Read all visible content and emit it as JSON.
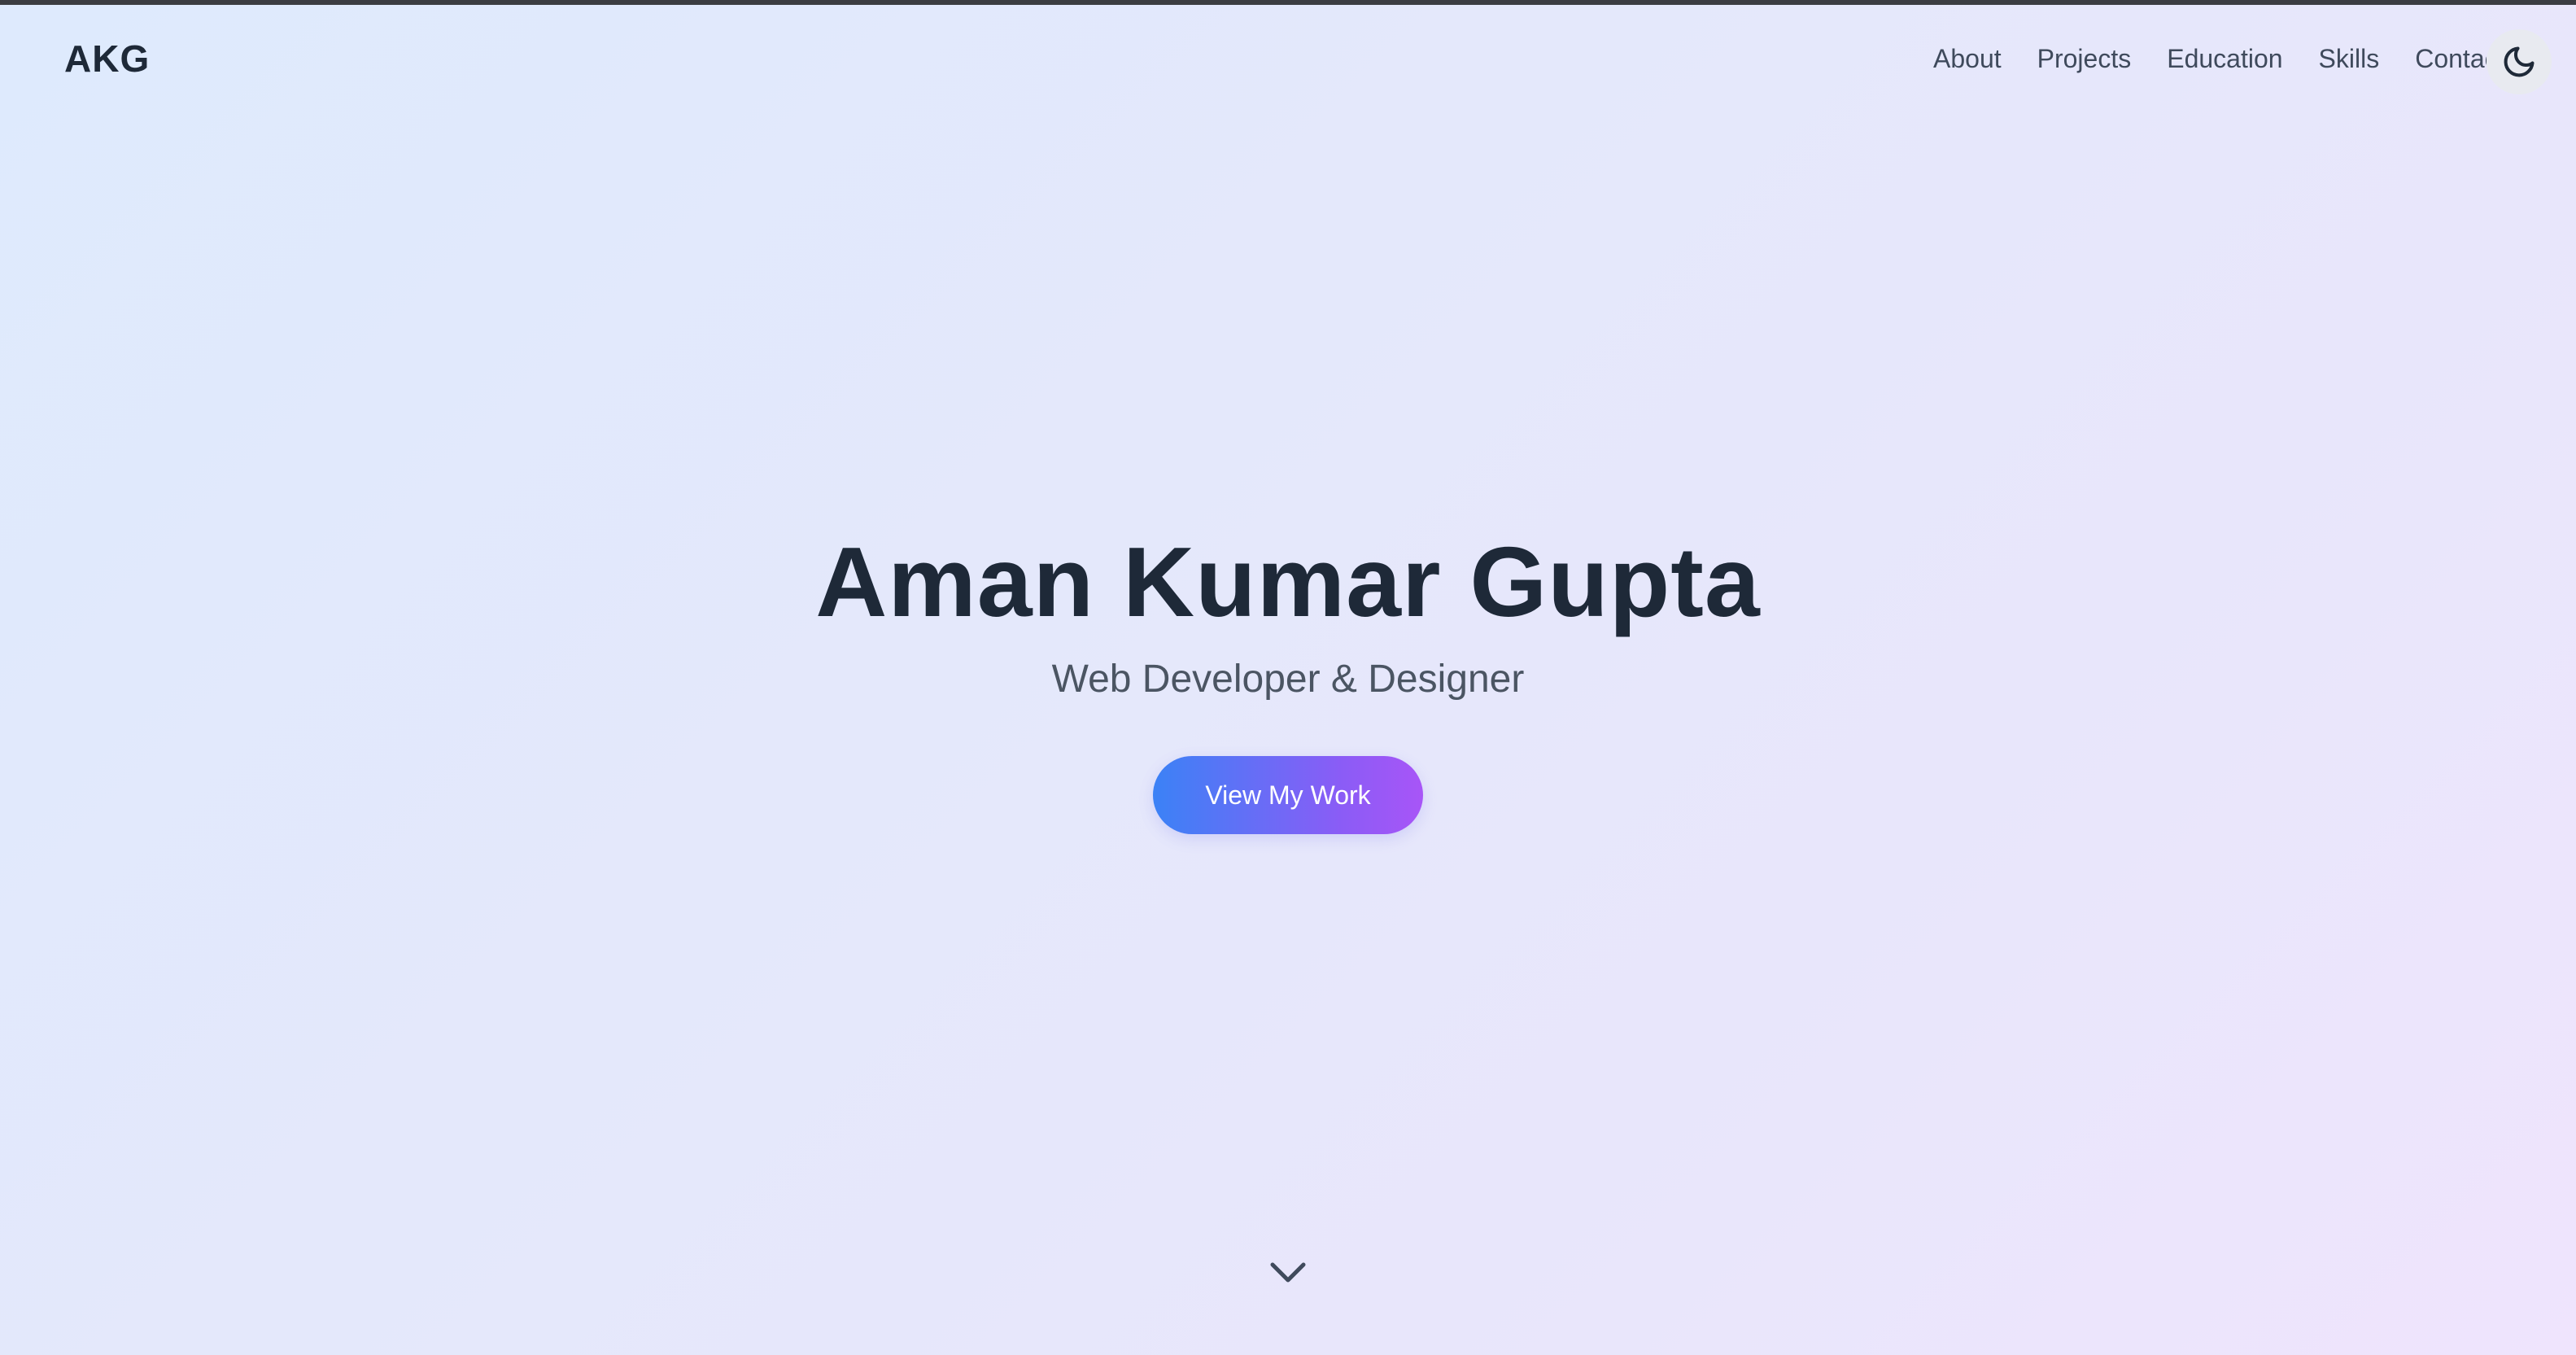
{
  "brand": {
    "logo_text": "AKG"
  },
  "nav": {
    "items": [
      {
        "label": "About"
      },
      {
        "label": "Projects"
      },
      {
        "label": "Education"
      },
      {
        "label": "Skills"
      },
      {
        "label": "Contact"
      }
    ],
    "theme_toggle_icon": "moon-icon"
  },
  "hero": {
    "name": "Aman Kumar Gupta",
    "role": "Web Developer & Designer",
    "cta_label": "View My Work",
    "scroll_icon": "chevron-down-icon"
  },
  "colors": {
    "heading": "#1e2938",
    "body_text": "#4b5563",
    "cta_gradient_start": "#3b82f6",
    "cta_gradient_end": "#a855f7",
    "top_strip": "#3b3d42"
  }
}
